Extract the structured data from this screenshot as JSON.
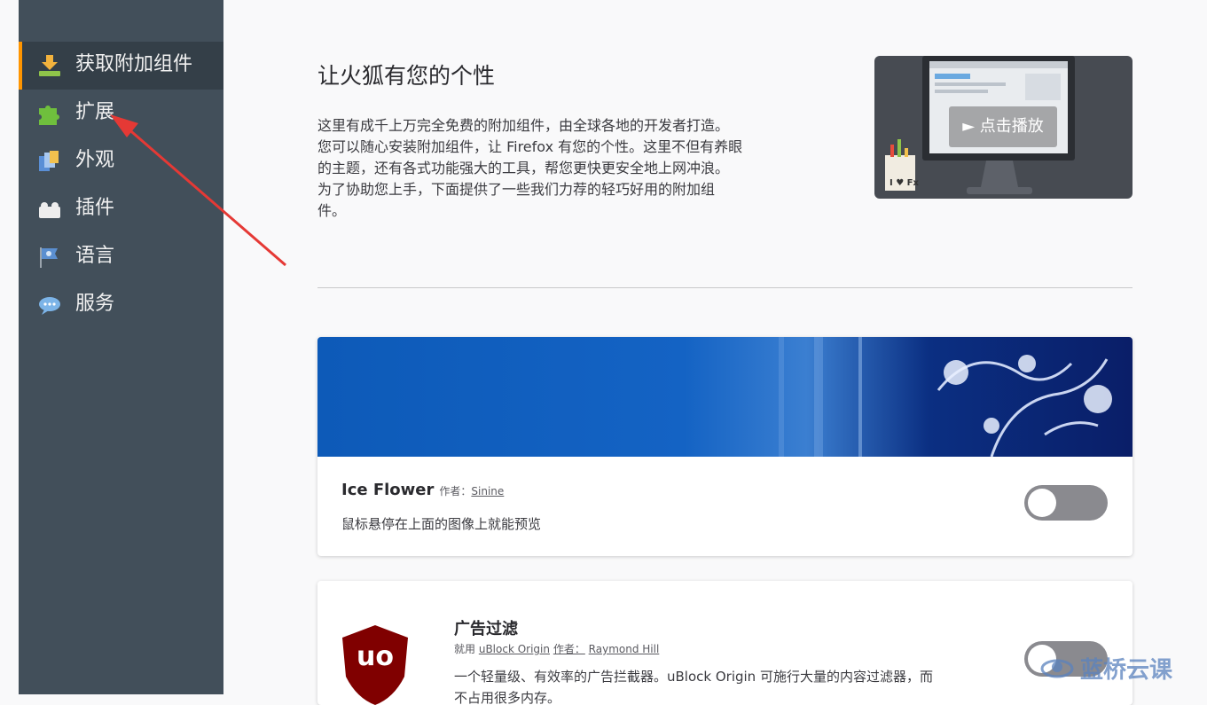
{
  "sidebar": {
    "items": [
      {
        "label": "获取附加组件",
        "icon": "get-addons-icon",
        "selected": true
      },
      {
        "label": "扩展",
        "icon": "puzzle-piece-icon"
      },
      {
        "label": "外观",
        "icon": "appearance-icon"
      },
      {
        "label": "插件",
        "icon": "plugin-brick-icon"
      },
      {
        "label": "语言",
        "icon": "language-flag-icon"
      },
      {
        "label": "服务",
        "icon": "services-cloud-icon"
      }
    ]
  },
  "hero": {
    "title": "让火狐有您的个性",
    "description_lines": [
      "这里有成千上万完全免费的附加组件，由全球各地的开发者打造。",
      "您可以随心安装附加组件，让 Firefox 有您的个性。这里不但有养眼",
      "的主题，还有各式功能强大的工具，帮您更快更安全地上网冲浪。",
      "为了协助您上手，下面提供了一些我们力荐的轻巧好用的附加组",
      "件。"
    ],
    "video": {
      "play_label": "► 点击播放",
      "badge_text": "I ♥ Fx"
    }
  },
  "addons": [
    {
      "name": "Ice Flower",
      "by_label": "作者：",
      "author": "Sinine",
      "description": "鼠标悬停在上面的图像上就能预览",
      "enabled": false
    },
    {
      "name": "广告过滤",
      "prefix": "就用",
      "product": "uBlock Origin",
      "by_label": "作者：",
      "author": "Raymond Hill",
      "description": "一个轻量级、有效率的广告拦截器。uBlock Origin 可施行大量的内容过滤器，而",
      "description_line2": "不占用很多内存。",
      "logo_text": "uo",
      "enabled": false
    }
  ],
  "watermark": {
    "text": "蓝桥云课"
  },
  "colors": {
    "sidebar_bg": "#424f5a",
    "sidebar_selected": "#343f48",
    "accent": "#ff9500",
    "annotation_arrow": "#e53935",
    "banner_blue": "#0d47a1",
    "ublock_red": "#800000"
  }
}
